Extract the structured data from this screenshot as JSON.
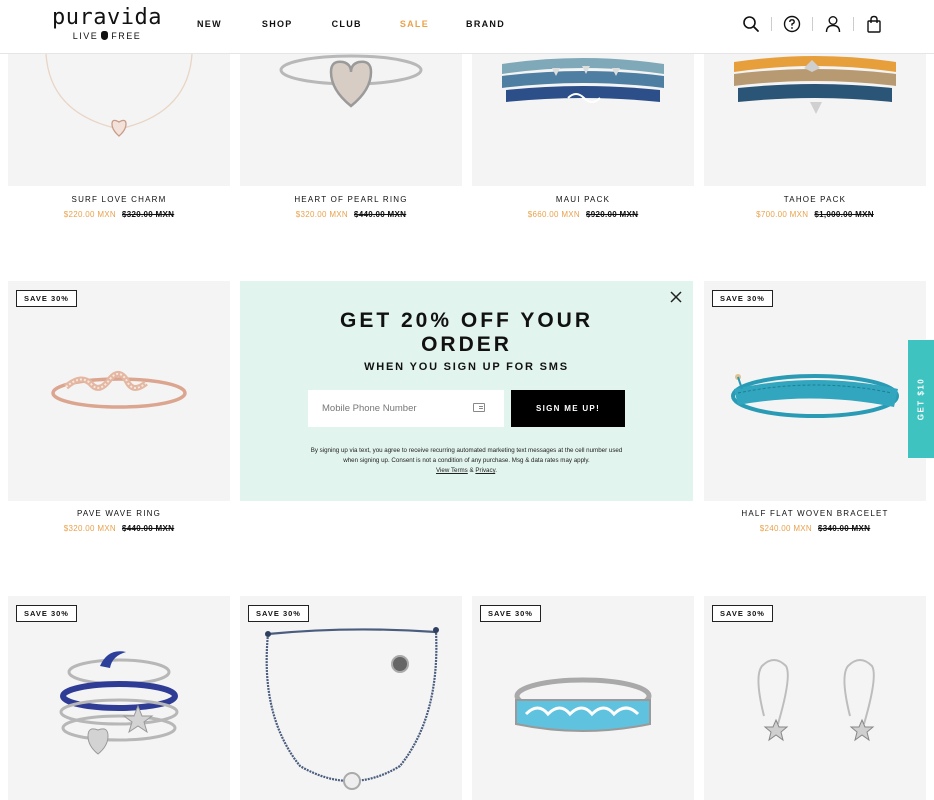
{
  "header": {
    "logo_word": "puravida",
    "logo_tag_left": "LIVE",
    "logo_tag_right": "FREE",
    "nav": [
      "NEW",
      "SHOP",
      "CLUB",
      "SALE",
      "BRAND"
    ],
    "icons": [
      "search-icon",
      "help-icon",
      "account-icon",
      "cart-icon"
    ]
  },
  "products": [
    {
      "name": "SURF LOVE CHARM",
      "price": "$220.00 MXN",
      "old_price": "$320.00 MXN",
      "badge": ""
    },
    {
      "name": "HEART OF PEARL RING",
      "price": "$320.00 MXN",
      "old_price": "$440.00 MXN",
      "badge": ""
    },
    {
      "name": "MAUI PACK",
      "price": "$660.00 MXN",
      "old_price": "$920.00 MXN",
      "badge": ""
    },
    {
      "name": "TAHOE PACK",
      "price": "$700.00 MXN",
      "old_price": "$1,000.00 MXN",
      "badge": ""
    },
    {
      "name": "PAVE WAVE RING",
      "price": "$320.00 MXN",
      "old_price": "$440.00 MXN",
      "badge": "SAVE 30%"
    },
    {
      "name": "HALF FLAT WOVEN BRACELET",
      "price": "$240.00 MXN",
      "old_price": "$340.00 MXN",
      "badge": "SAVE 30%"
    },
    {
      "badge": "SAVE 30%"
    },
    {
      "badge": "SAVE 30%"
    },
    {
      "badge": "SAVE 30%"
    },
    {
      "badge": "SAVE 30%"
    }
  ],
  "popup": {
    "title_line1": "GET 20% OFF YOUR",
    "title_line2": "ORDER",
    "subtitle": "WHEN YOU SIGN UP FOR SMS",
    "phone_placeholder": "Mobile Phone Number",
    "button": "SIGN ME UP!",
    "legal_text": "By signing up via text, you agree to receive recurring automated marketing text messages at the cell number used when signing up. Consent is not a condition of any purchase. Msg & data rates may apply.",
    "terms_link": "View Terms",
    "amp": "&",
    "privacy_link": "Privacy",
    "period": "."
  },
  "side_tab": {
    "label": "GET $10"
  },
  "colors": {
    "sale": "#e9a24c",
    "popup_bg": "#e2f4ee",
    "side_tab": "#3fc3c0",
    "tile_bg": "#f4f4f4"
  }
}
